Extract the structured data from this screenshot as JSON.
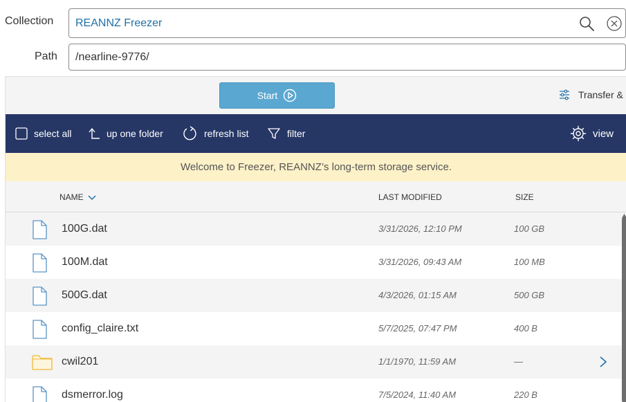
{
  "collection": {
    "label": "Collection",
    "value": "REANNZ Freezer"
  },
  "path": {
    "label": "Path",
    "value": "/nearline-9776/"
  },
  "actions": {
    "start_label": "Start",
    "transfer_label": "Transfer &"
  },
  "toolbar": {
    "select_all": "select all",
    "up_one_folder": "up one folder",
    "refresh_list": "refresh list",
    "filter": "filter",
    "view": "view"
  },
  "banner": "Welcome to Freezer, REANNZ’s long-term storage service.",
  "columns": {
    "name": "NAME",
    "last_modified": "LAST MODIFIED",
    "size": "SIZE"
  },
  "files": [
    {
      "name": "100G.dat",
      "modified": "3/31/2026, 12:10 PM",
      "size": "100 GB",
      "type": "file"
    },
    {
      "name": "100M.dat",
      "modified": "3/31/2026, 09:43 AM",
      "size": "100 MB",
      "type": "file"
    },
    {
      "name": "500G.dat",
      "modified": "4/3/2026, 01:15 AM",
      "size": "500 GB",
      "type": "file"
    },
    {
      "name": "config_claire.txt",
      "modified": "5/7/2025, 07:47 PM",
      "size": "400 B",
      "type": "file"
    },
    {
      "name": "cwil201",
      "modified": "1/1/1970, 11:59 AM",
      "size": "—",
      "type": "folder"
    },
    {
      "name": "dsmerror.log",
      "modified": "7/5/2024, 11:40 AM",
      "size": "220 B",
      "type": "file"
    }
  ],
  "colors": {
    "toolbar_bg": "#263766",
    "start_button": "#5aa8d2",
    "banner_bg": "#fdf1c8",
    "link_blue": "#1f6fa8",
    "folder_yellow": "#f0b83c"
  },
  "icons": [
    "search-icon",
    "clear-icon",
    "play-circle-icon",
    "sliders-icon",
    "checkbox-icon",
    "up-arrow-icon",
    "refresh-icon",
    "filter-icon",
    "gear-icon",
    "chevron-down-icon",
    "file-icon",
    "folder-icon",
    "chevron-right-icon"
  ]
}
